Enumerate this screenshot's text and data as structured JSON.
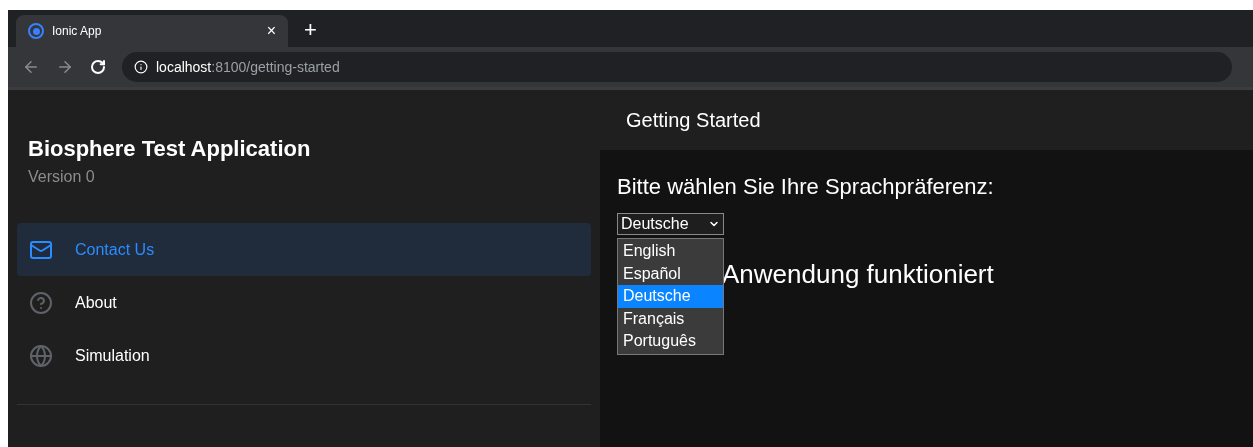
{
  "browser": {
    "tab_title": "Ionic App",
    "tab_close": "×",
    "new_tab": "+",
    "url_host": "localhost",
    "url_path": ":8100/getting-started"
  },
  "sidebar": {
    "title": "Biosphere Test Application",
    "subtitle": "Version 0",
    "items": [
      {
        "label": "Contact Us",
        "selected": true
      },
      {
        "label": "About",
        "selected": false
      },
      {
        "label": "Simulation",
        "selected": false
      }
    ]
  },
  "header": {
    "title": "Getting Started"
  },
  "content": {
    "prompt": "Bitte wählen Sie Ihre Sprachpräferenz:",
    "heading": "Anwendung funktioniert",
    "language_select": {
      "value": "Deutsche",
      "expanded": true,
      "options": [
        {
          "label": "English",
          "selected": false
        },
        {
          "label": "Español",
          "selected": false
        },
        {
          "label": "Deutsche",
          "selected": true
        },
        {
          "label": "Français",
          "selected": false
        },
        {
          "label": "Português",
          "selected": false
        }
      ]
    }
  }
}
